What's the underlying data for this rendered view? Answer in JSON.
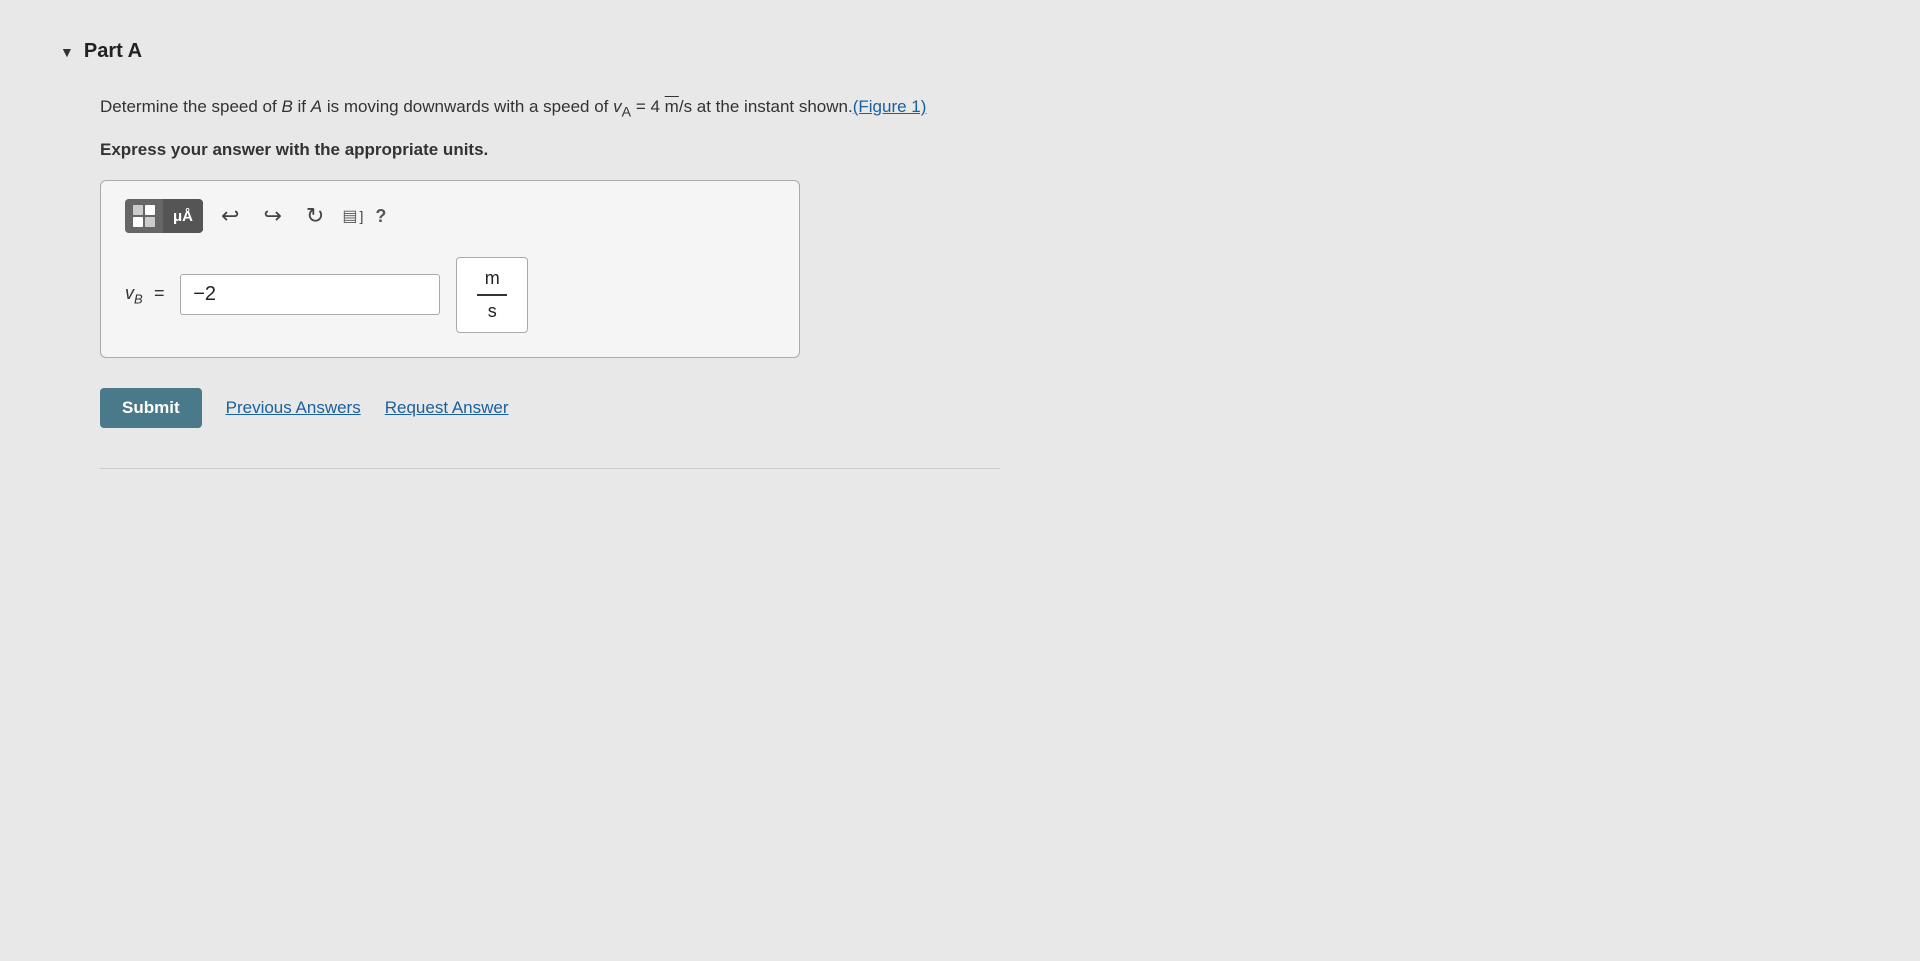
{
  "part": {
    "label": "Part A",
    "arrow": "▼"
  },
  "question": {
    "text_part1": "Determine the speed of ",
    "B_italic": "B",
    "text_part2": " if ",
    "A_italic": "A",
    "text_part3": " is moving downwards with a speed of ",
    "v_A": "v",
    "v_A_sub": "A",
    "text_part4": " = 4 ",
    "unit_m": "m",
    "unit_s": "s",
    "text_part5": " at the instant shown.",
    "figure_link": "(Figure 1)"
  },
  "express_text": "Express your answer with the appropriate units.",
  "toolbar": {
    "mu_label": "μÅ",
    "undo_icon": "↩",
    "redo_icon": "↪",
    "refresh_icon": "↻",
    "snippet_icon": "▤",
    "snippet_bracket": "]",
    "help_icon": "?"
  },
  "answer": {
    "variable_label": "v",
    "variable_sub": "B",
    "equals": "=",
    "input_value": "−2",
    "unit_numerator": "m",
    "unit_denominator": "s"
  },
  "buttons": {
    "submit": "Submit",
    "previous_answers": "Previous Answers",
    "request_answer": "Request Answer"
  }
}
